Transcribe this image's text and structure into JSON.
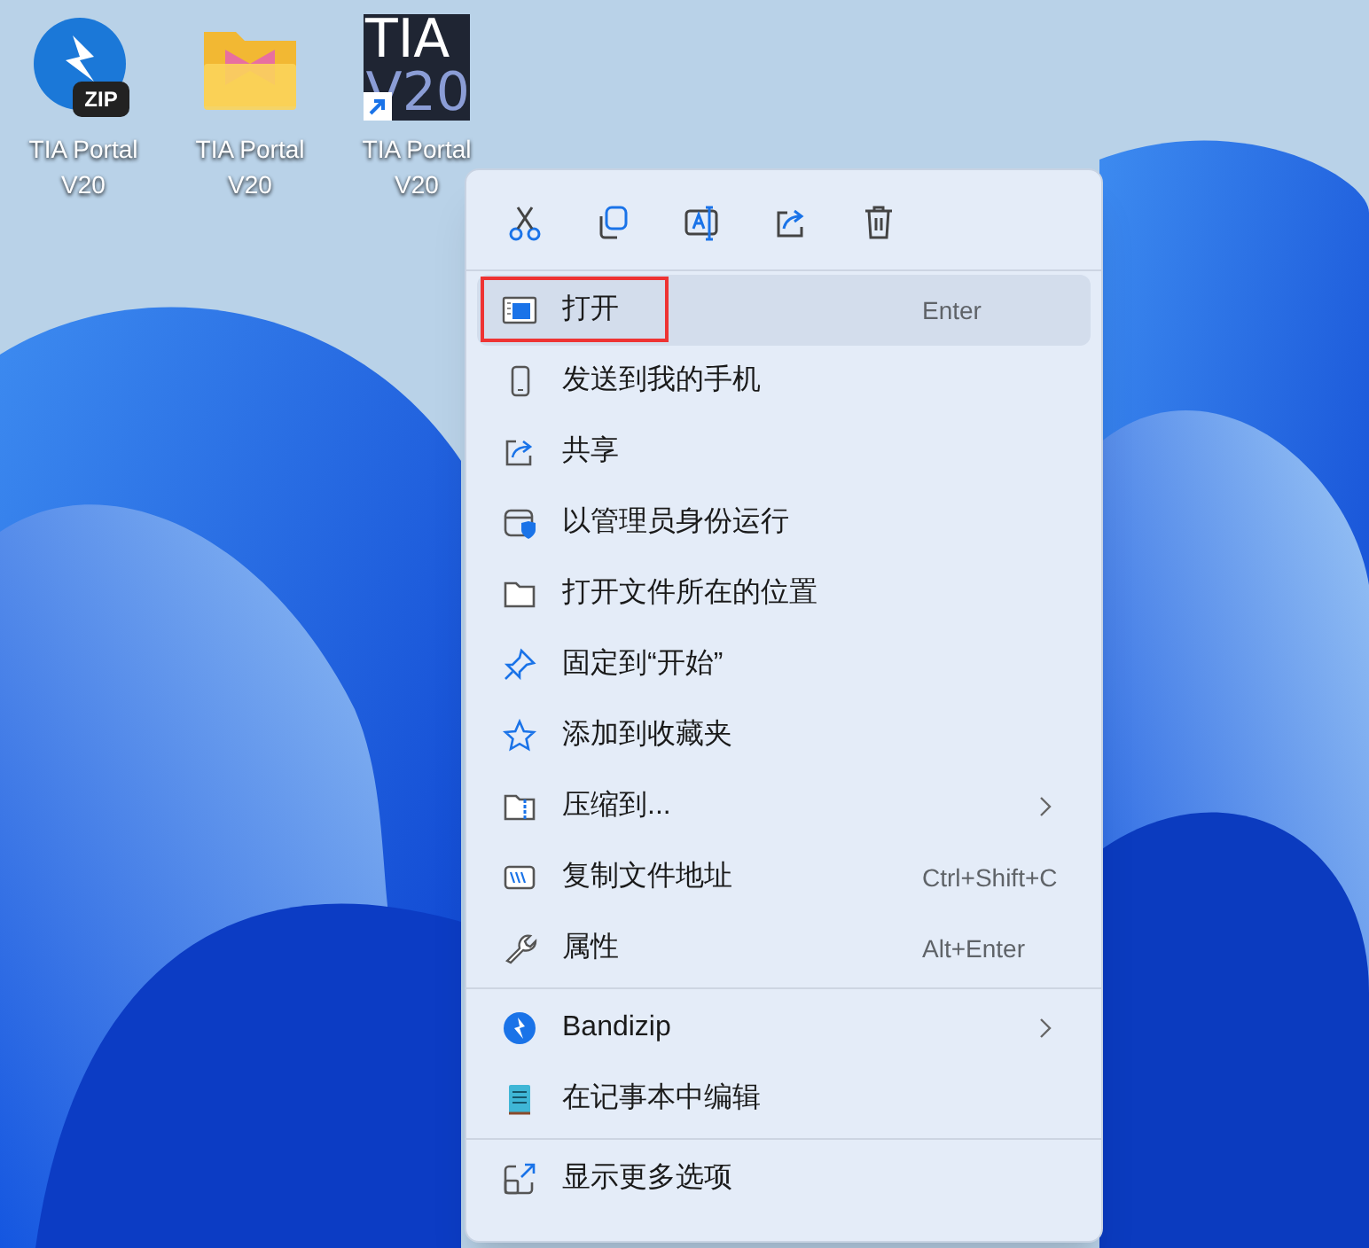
{
  "desktop_icons": [
    {
      "label": "TIA Portal V20",
      "badge": "ZIP"
    },
    {
      "label": "TIA Portal V20"
    },
    {
      "label": "TIA Portal V20",
      "logo_text": [
        "TIA",
        "V20"
      ]
    }
  ],
  "context_menu": {
    "sections": [
      {
        "items": [
          {
            "label": "打开",
            "shortcut": "Enter",
            "submenu": false,
            "selected": true,
            "outlined": true
          },
          {
            "label": "发送到我的手机",
            "submenu": false,
            "selected": false,
            "outlined": false
          },
          {
            "label": "共享",
            "submenu": false,
            "selected": false,
            "outlined": false
          },
          {
            "label": "以管理员身份运行",
            "submenu": false,
            "selected": false,
            "outlined": false
          },
          {
            "label": "打开文件所在的位置",
            "submenu": false,
            "selected": false,
            "outlined": false
          },
          {
            "label": "固定到“开始”",
            "submenu": false,
            "selected": false,
            "outlined": false
          },
          {
            "label": "添加到收藏夹",
            "submenu": false,
            "selected": false,
            "outlined": false
          },
          {
            "label": "压缩到...",
            "submenu": true,
            "selected": false,
            "outlined": false
          },
          {
            "label": "复制文件地址",
            "shortcut": "Ctrl+Shift+C",
            "submenu": false,
            "selected": false,
            "outlined": false
          },
          {
            "label": "属性",
            "shortcut": "Alt+Enter",
            "submenu": false,
            "selected": false,
            "outlined": false
          }
        ]
      },
      {
        "items": [
          {
            "label": "Bandizip",
            "submenu": true,
            "selected": false,
            "outlined": false
          },
          {
            "label": "在记事本中编辑",
            "submenu": false,
            "selected": false,
            "outlined": false
          }
        ]
      },
      {
        "items": [
          {
            "label": "显示更多选项",
            "submenu": false,
            "selected": false,
            "outlined": false
          }
        ]
      }
    ]
  }
}
